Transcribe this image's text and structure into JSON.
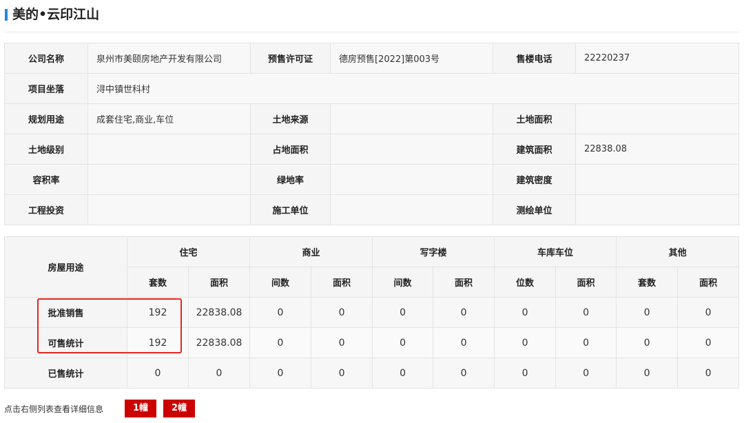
{
  "title": "美的•云印江山",
  "info": {
    "company_label": "公司名称",
    "company_value": "泉州市美颐房地产开发有限公司",
    "permit_label": "预售许可证",
    "permit_value": "德房预售[2022]第003号",
    "phone_label": "售楼电话",
    "phone_value": "22220237",
    "location_label": "项目坐落",
    "location_value": "浔中镇世科村",
    "usage_label": "规划用途",
    "usage_value": "成套住宅,商业,车位",
    "land_source_label": "土地来源",
    "land_source_value": "",
    "land_area_label": "土地面积",
    "land_area_value": "",
    "land_grade_label": "土地级别",
    "land_grade_value": "",
    "occupied_area_label": "占地面积",
    "occupied_area_value": "",
    "floor_area_label": "建筑面积",
    "floor_area_value": "22838.08",
    "plot_ratio_label": "容积率",
    "plot_ratio_value": "",
    "green_ratio_label": "绿地率",
    "green_ratio_value": "",
    "density_label": "建筑密度",
    "density_value": "",
    "investment_label": "工程投资",
    "investment_value": "",
    "contractor_label": "施工单位",
    "contractor_value": "",
    "surveyor_label": "测绘单位",
    "surveyor_value": ""
  },
  "stats": {
    "purpose_label": "房屋用途",
    "groups": [
      "住宅",
      "商业",
      "写字楼",
      "车库车位",
      "其他"
    ],
    "subheaders": [
      "套数",
      "面积",
      "间数",
      "面积",
      "间数",
      "面积",
      "位数",
      "面积",
      "套数",
      "面积"
    ],
    "rows": [
      {
        "label": "批准销售",
        "values": [
          "192",
          "22838.08",
          "0",
          "0",
          "0",
          "0",
          "0",
          "0",
          "0",
          "0"
        ]
      },
      {
        "label": "可售统计",
        "values": [
          "192",
          "22838.08",
          "0",
          "0",
          "0",
          "0",
          "0",
          "0",
          "0",
          "0"
        ]
      },
      {
        "label": "已售统计",
        "values": [
          "0",
          "0",
          "0",
          "0",
          "0",
          "0",
          "0",
          "0",
          "0",
          "0"
        ]
      }
    ]
  },
  "footer": {
    "hint": "点击右侧列表查看详细信息",
    "buttons": [
      "1幢",
      "2幢"
    ]
  },
  "colors": {
    "accent": "#1e88e5",
    "button": "#cc0000",
    "highlight": "#e8251f"
  }
}
